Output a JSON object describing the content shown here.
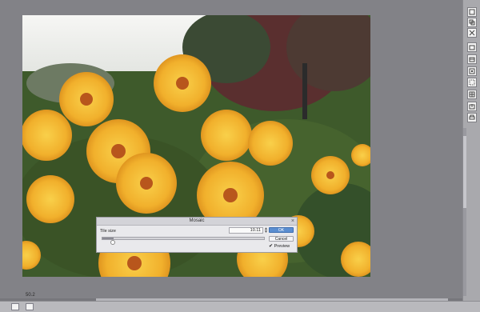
{
  "dialog": {
    "title": "Mosaic",
    "close_glyph": "×",
    "tile_size_label": "Tile size",
    "tile_size_value": "10.11",
    "tile_size_level": 0.07,
    "ok_label": "OK",
    "cancel_label": "Cancel",
    "preview_label": "Preview",
    "preview_checked": true,
    "preview_check_glyph": "✔"
  },
  "status": {
    "zoom": "50.2"
  },
  "colors": {
    "workspace": "#828287",
    "ok_button": "#5b8ed0",
    "flower": "#f2b631",
    "foliage": "#3f5a2a"
  },
  "right_panel_icons": [
    "panel-icon-1",
    "panel-icon-2",
    "panel-icon-3",
    "panel-icon-4",
    "panel-icon-5",
    "panel-icon-6",
    "panel-icon-7",
    "panel-icon-8"
  ]
}
